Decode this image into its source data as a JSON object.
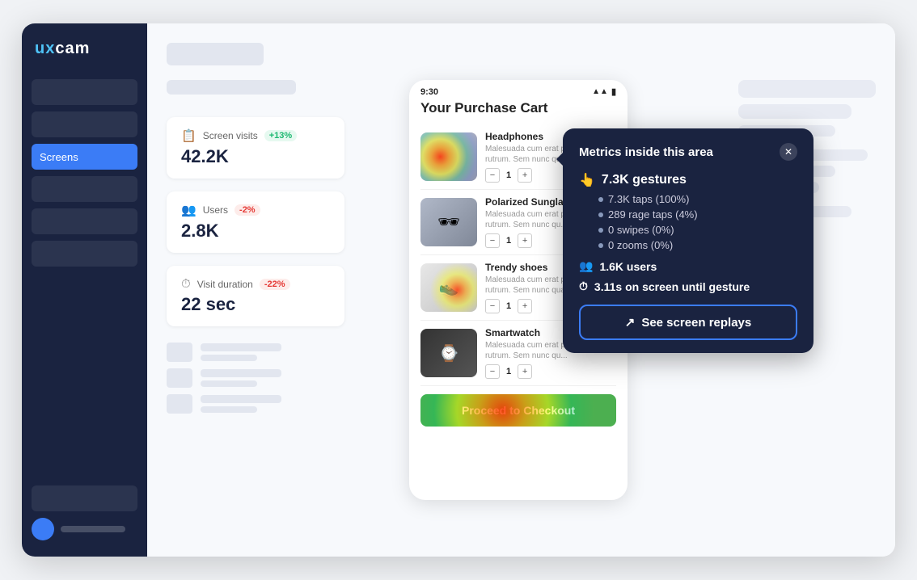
{
  "sidebar": {
    "logo": "uxcam",
    "active_item": "Screens",
    "items": [
      {
        "label": "Screens",
        "active": true
      },
      {
        "label": "",
        "active": false
      },
      {
        "label": "",
        "active": false
      },
      {
        "label": "",
        "active": false
      },
      {
        "label": "",
        "active": false
      },
      {
        "label": "",
        "active": false
      }
    ]
  },
  "stats": {
    "screen_visits": {
      "label": "Screen visits",
      "badge": "+13%",
      "badge_type": "green",
      "value": "42.2K",
      "icon": "📋"
    },
    "users": {
      "label": "Users",
      "badge": "-2%",
      "badge_type": "red",
      "value": "2.8K",
      "icon": "👥"
    },
    "visit_duration": {
      "label": "Visit duration",
      "badge": "-22%",
      "badge_type": "red",
      "value": "22 sec",
      "icon": "⏱"
    }
  },
  "phone": {
    "status_time": "9:30",
    "title": "Your Purchase Cart",
    "items": [
      {
        "name": "Headphones",
        "desc": "Malesuada cum erat posuere rutrum. Sem nunc quam orci...",
        "qty": "1",
        "has_heatmap": true,
        "selected": true
      },
      {
        "name": "Polarized Sunglasses",
        "desc": "Malesuada cum erat posuere rutrum. Sem nunc qu...",
        "qty": "1",
        "has_heatmap": false,
        "selected": false
      },
      {
        "name": "Trendy shoes",
        "desc": "Malesuada cum erat posuere rutrum. Sem nunc quam...",
        "qty": "1",
        "has_heatmap": true,
        "selected": false
      },
      {
        "name": "Smartwatch",
        "desc": "Malesuada cum erat posuere rutrum. Sem nunc qu...",
        "qty": "1",
        "has_heatmap": false,
        "selected": false
      }
    ],
    "checkout_label": "Proceed to Checkout"
  },
  "tooltip": {
    "title": "Metrics inside this area",
    "gestures_label": "7.3K gestures",
    "gestures_icon": "👆",
    "sub_items": [
      "7.3K taps (100%)",
      "289 rage taps (4%)",
      "0 swipes (0%)",
      "0 zooms (0%)"
    ],
    "users_label": "1.6K users",
    "users_icon": "👥",
    "time_label": "3.11s on screen until gesture",
    "time_icon": "⏱",
    "see_replays_label": "See screen replays",
    "see_replays_icon": "↗"
  }
}
